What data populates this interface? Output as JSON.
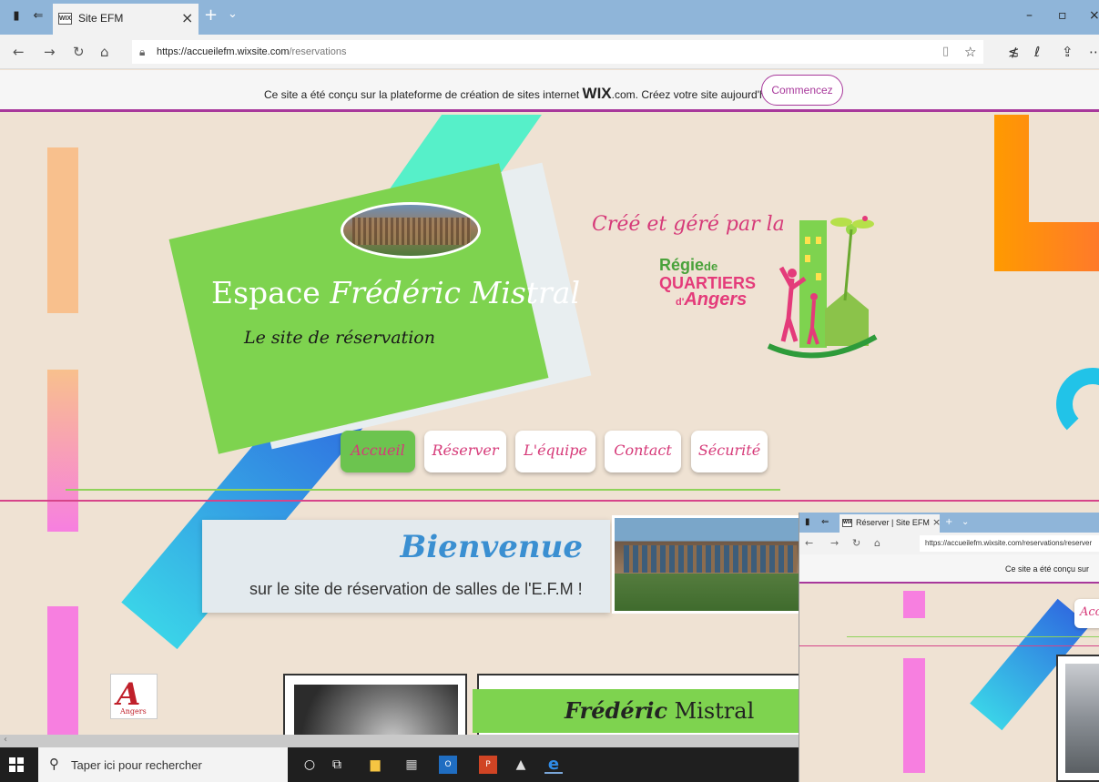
{
  "browser": {
    "tab_title": "Site EFM",
    "tab_favicon": "WIX",
    "url_base": "https://accueilefm.wixsite.com",
    "url_path": "/reservations"
  },
  "wix_banner": {
    "message_before": "Ce site a été conçu sur la plateforme de création de sites internet ",
    "brand": "WIX",
    "message_after": ".com. Créez votre site aujourd'hui.",
    "cta_label": "Commencez"
  },
  "header": {
    "title_plain": "Espace ",
    "title_script": "Frédéric Mistral",
    "subtitle": "Le site de réservation",
    "created_by": "Créé et géré par la",
    "partner_line1": "Régie",
    "partner_line1_small": "de",
    "partner_line2": "QUARTIERS",
    "partner_line3_small": "d'",
    "partner_line3": "Angers"
  },
  "nav": [
    {
      "label": "Accueil",
      "active": true
    },
    {
      "label": "Réserver",
      "active": false
    },
    {
      "label": "L'équipe",
      "active": false
    },
    {
      "label": "Contact",
      "active": false
    },
    {
      "label": "Sécurité",
      "active": false
    }
  ],
  "welcome": {
    "title": "Bienvenue",
    "subtitle": "sur le site de réservation de salles de l'E.F.M !"
  },
  "angers_logo": {
    "letter": "A",
    "text": "Angers"
  },
  "fm_card": {
    "title_script": "Frédéric",
    "title_plain": " Mistral"
  },
  "overlay": {
    "tab_title": "Réserver | Site EFM",
    "tab_favicon": "WIX",
    "url": "https://accueilefm.wixsite.com/reservations/reserver",
    "banner_partial": "Ce site a été conçu sur",
    "nav_partial": "Acc"
  },
  "taskbar": {
    "search_placeholder": "Taper ici pour rechercher"
  },
  "colors": {
    "accent_green": "#7ed34f",
    "accent_pink": "#d63a79",
    "wix_purple": "#a8389b",
    "page_bg": "#efe2d3"
  }
}
